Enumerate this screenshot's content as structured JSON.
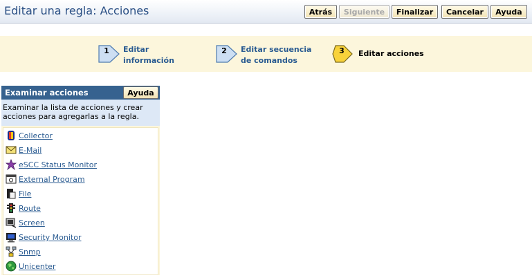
{
  "header": {
    "title": "Editar una regla: Acciones",
    "buttons": {
      "back": "Atrás",
      "next": "Siguiente",
      "finish": "Finalizar",
      "cancel": "Cancelar",
      "help": "Ayuda"
    }
  },
  "steps": [
    {
      "number": "1",
      "line1": "Editar",
      "line2": "información",
      "state": "done"
    },
    {
      "number": "2",
      "line1": "Editar secuencia",
      "line2": "de comandos",
      "state": "done"
    },
    {
      "number": "3",
      "line1": "Editar acciones",
      "line2": "",
      "state": "current"
    }
  ],
  "panel": {
    "title": "Examinar acciones",
    "help": "Ayuda",
    "description_line1": "Examinar la lista de acciones y crear",
    "description_line2": "acciones para agregarlas a la regla.",
    "items": [
      {
        "label": "Collector",
        "icon": "collector-icon"
      },
      {
        "label": "E-Mail",
        "icon": "envelope-icon"
      },
      {
        "label": "eSCC Status Monitor",
        "icon": "status-monitor-icon"
      },
      {
        "label": "External Program",
        "icon": "program-window-icon"
      },
      {
        "label": "File",
        "icon": "file-icon"
      },
      {
        "label": "Route",
        "icon": "traffic-light-icon"
      },
      {
        "label": "Screen",
        "icon": "screen-icon"
      },
      {
        "label": "Security Monitor",
        "icon": "security-monitor-icon"
      },
      {
        "label": "Snmp",
        "icon": "snmp-network-icon"
      },
      {
        "label": "Unicenter",
        "icon": "globe-icon"
      }
    ]
  },
  "colors": {
    "title": "#2a4f84",
    "link": "#2a5b91",
    "panel_header": "#36628f",
    "band": "#fcf6dc",
    "step_arrow_done": "#cddff3",
    "step_arrow_current": "#f8d23a"
  }
}
